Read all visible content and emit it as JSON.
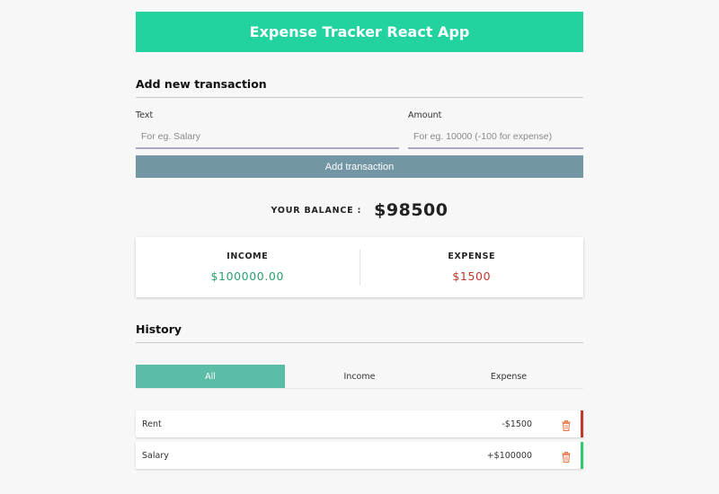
{
  "header": {
    "title": "Expense Tracker React App"
  },
  "form": {
    "section_title": "Add new transaction",
    "text_label": "Text",
    "text_placeholder": "For eg. Salary",
    "amount_label": "Amount",
    "amount_placeholder": "For eg. 10000 (-100 for expense)",
    "submit_label": "Add transaction"
  },
  "balance": {
    "label": "YOUR BALANCE :",
    "value": "$98500"
  },
  "summary": {
    "income_label": "INCOME",
    "income_value": "$100000.00",
    "expense_label": "EXPENSE",
    "expense_value": "$1500"
  },
  "history": {
    "title": "History",
    "tabs": [
      {
        "label": "All",
        "active": true
      },
      {
        "label": "Income",
        "active": false
      },
      {
        "label": "Expense",
        "active": false
      }
    ],
    "transactions": [
      {
        "text": "Rent",
        "amount": "-$1500",
        "type": "expense"
      },
      {
        "text": "Salary",
        "amount": "+$100000",
        "type": "income"
      }
    ]
  },
  "colors": {
    "header": "#22d3a0",
    "button": "#7296a3",
    "tab_active": "#5bbda5",
    "income": "#2c9f6f",
    "expense": "#c0392b",
    "income_bar": "#2ecc71",
    "expense_bar": "#c0392b",
    "delete_icon": "#e8713c"
  },
  "icons": {
    "delete": "trash-icon"
  }
}
